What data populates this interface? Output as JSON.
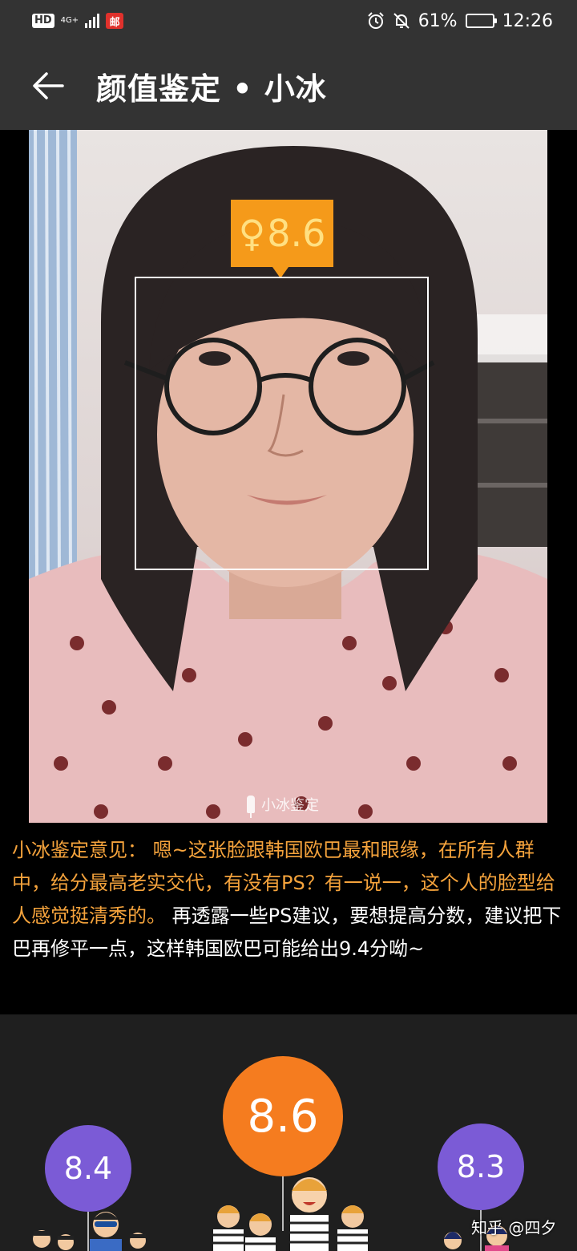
{
  "status_bar": {
    "hd_label": "HD",
    "network_label": "4G+",
    "app_icon_label": "邮",
    "battery_text": "61%",
    "battery_level": 0.61,
    "time": "12:26"
  },
  "app_bar": {
    "title": "颜值鉴定 • 小冰"
  },
  "photo": {
    "score_symbol": "♀",
    "score": "8.6",
    "watermark": "小冰鉴定"
  },
  "verdict": {
    "highlight": "小冰鉴定意见： 嗯~这张脸跟韩国欧巴最和眼缘，在所有人群中，给分最高老实交代，有没有PS？有一说一，这个人的脸型给人感觉挺清秀的。",
    "advice": " 再透露一些PS建议，要想提高分数，建议把下巴再修平一点，这样韩国欧巴可能给出9.4分呦~"
  },
  "scores": {
    "left": "8.4",
    "center": "8.6",
    "right": "8.3"
  },
  "credit": "知乎 @四夕",
  "colors": {
    "bar_bg": "#333333",
    "accent_orange": "#f57c1f",
    "score_tag": "#f59a1a",
    "verdict_highlight": "#f5a33c",
    "bubble_purple": "#7b5bd6"
  }
}
